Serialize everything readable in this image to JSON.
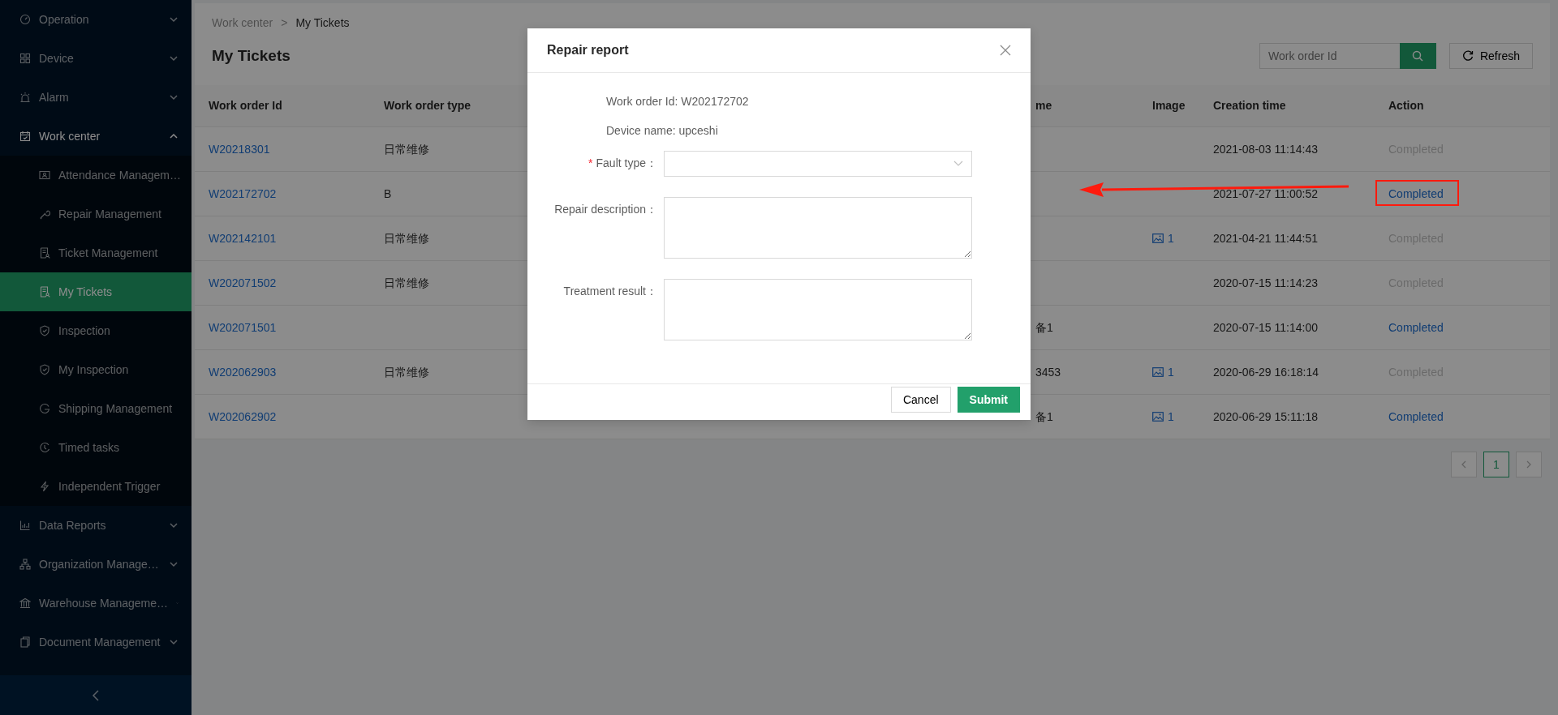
{
  "sidebar": {
    "items": [
      {
        "label": "Operation",
        "expanded": false,
        "selected": false
      },
      {
        "label": "Device",
        "expanded": false,
        "selected": false
      },
      {
        "label": "Alarm",
        "expanded": false,
        "selected": false
      },
      {
        "label": "Work center",
        "expanded": true,
        "selected": false,
        "children": [
          {
            "label": "Attendance Managem…",
            "selected": false
          },
          {
            "label": "Repair Management",
            "selected": false
          },
          {
            "label": "Ticket Management",
            "selected": false
          },
          {
            "label": "My Tickets",
            "selected": true
          },
          {
            "label": "Inspection",
            "selected": false
          },
          {
            "label": "My Inspection",
            "selected": false
          },
          {
            "label": "Shipping Management",
            "selected": false
          },
          {
            "label": "Timed tasks",
            "selected": false
          },
          {
            "label": "Independent Trigger",
            "selected": false
          }
        ]
      },
      {
        "label": "Data Reports",
        "expanded": false,
        "selected": false
      },
      {
        "label": "Organization Manage…",
        "expanded": false,
        "selected": false
      },
      {
        "label": "Warehouse Manageme…",
        "expanded": false,
        "selected": false
      },
      {
        "label": "Document Management",
        "expanded": false,
        "selected": false
      }
    ]
  },
  "breadcrumb": {
    "items": [
      "Work center",
      "My Tickets"
    ],
    "separator": ">"
  },
  "page_title": "My Tickets",
  "search": {
    "placeholder": "Work order Id"
  },
  "refresh_button": "Refresh",
  "table": {
    "columns": [
      "Work order Id",
      "Work order type",
      "me",
      "Image",
      "Creation time",
      "Action"
    ],
    "rows": [
      {
        "id": "W20218301",
        "type": "日常维修",
        "column_3": "",
        "image": "",
        "created": "2021-08-03 11:14:43",
        "action": {
          "label": "Completed",
          "disabled": true
        }
      },
      {
        "id": "W202172702",
        "type": "B",
        "column_3": "",
        "image": "",
        "created": "2021-07-27 11:00:52",
        "action": {
          "label": "Completed",
          "disabled": false
        }
      },
      {
        "id": "W202142101",
        "type": "日常维修",
        "column_3": "",
        "image": "1",
        "created": "2021-04-21 11:44:51",
        "action": {
          "label": "Completed",
          "disabled": true
        }
      },
      {
        "id": "W202071502",
        "type": "日常维修",
        "column_3": "",
        "image": "",
        "created": "2020-07-15 11:14:23",
        "action": {
          "label": "Completed",
          "disabled": true
        }
      },
      {
        "id": "W202071501",
        "type": "",
        "column_3": "备1",
        "image": "",
        "created": "2020-07-15 11:14:00",
        "action": {
          "label": "Completed",
          "disabled": false
        }
      },
      {
        "id": "W202062903",
        "type": "日常维修",
        "column_3": "3453",
        "image": "1",
        "created": "2020-06-29 16:18:14",
        "action": {
          "label": "Completed",
          "disabled": true
        }
      },
      {
        "id": "W202062902",
        "type": "",
        "column_3": "备1",
        "image": "1",
        "created": "2020-06-29 15:11:18",
        "action": {
          "label": "Completed",
          "disabled": false
        }
      }
    ]
  },
  "pagination": {
    "pages": [
      {
        "label": "1",
        "selected": true
      }
    ]
  },
  "modal": {
    "title": "Repair report",
    "info": [
      "Work order Id: W202172702",
      "Device name: upceshi"
    ],
    "fields": [
      {
        "kind": "select",
        "label": "Fault type：",
        "required_mark": "*"
      },
      {
        "kind": "textarea",
        "label": "Repair description："
      },
      {
        "kind": "textarea",
        "label": "Treatment result："
      }
    ],
    "buttons": [
      {
        "label": "Cancel",
        "kind": "default"
      },
      {
        "label": "Submit",
        "kind": "primary"
      }
    ]
  }
}
